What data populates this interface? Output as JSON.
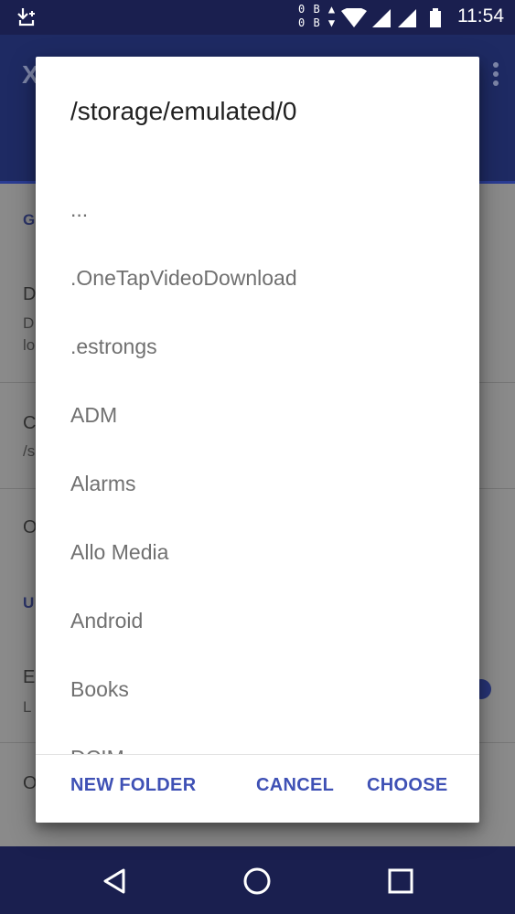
{
  "status_bar": {
    "net_up": "0 B",
    "net_down": "0 B",
    "time": "11:54"
  },
  "background_app": {
    "title_initial": "X",
    "header_1": "G",
    "row_1_title": "D",
    "row_1_sub_a": "D",
    "row_1_sub_b": "lo",
    "row_2_title": "C",
    "row_2_sub": "/s",
    "row_3_title": "O",
    "header_2": "U",
    "row_4_title": "E",
    "row_4_sub": "L",
    "row_5_title": "O"
  },
  "dialog": {
    "title": "/storage/emulated/0",
    "folders": [
      "...",
      ".OneTapVideoDownload",
      ".estrongs",
      "ADM",
      "Alarms",
      "Allo Media",
      "Android",
      "Books",
      "DCIM"
    ],
    "new_folder_label": "NEW FOLDER",
    "cancel_label": "CANCEL",
    "choose_label": "CHOOSE"
  },
  "colors": {
    "accent": "#3f51b5",
    "status_bar": "#1a1f4f",
    "scrim": "#888888"
  }
}
